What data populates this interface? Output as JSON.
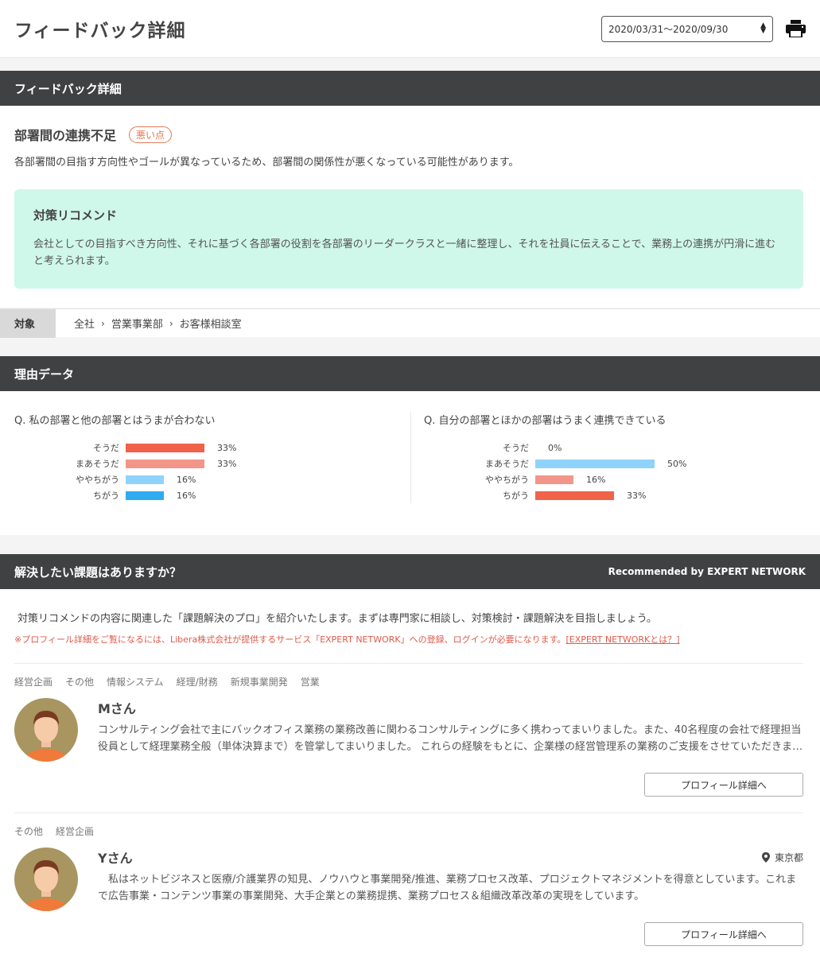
{
  "header": {
    "title": "フィードバック詳細",
    "date_range": "2020/03/31〜2020/09/30",
    "print_icon": "print-icon"
  },
  "feedback": {
    "section_title": "フィードバック詳細",
    "issue_title": "部署間の連携不足",
    "badge": "悪い点",
    "description": "各部署間の目指す方向性やゴールが異なっているため、部署間の関係性が悪くなっている可能性があります。",
    "recommend_title": "対策リコメンド",
    "recommend_body": "会社としての目指すべき方向性、それに基づく各部署の役割を各部署のリーダークラスと一緒に整理し、それを社員に伝えることで、業務上の連携が円滑に進むと考えられます。",
    "target_label": "対象",
    "breadcrumb": [
      "全社",
      "営業事業部",
      "お客様相談室"
    ]
  },
  "reason": {
    "section_title": "理由データ",
    "questions": [
      {
        "title": "Q.  私の部署と他の部署とはうまが合わない",
        "rows": [
          {
            "label": "そうだ",
            "value": 33,
            "display": "33%",
            "color": "#f0624a"
          },
          {
            "label": "まあそうだ",
            "value": 33,
            "display": "33%",
            "color": "#f2968a"
          },
          {
            "label": "ややちがう",
            "value": 16,
            "display": "16%",
            "color": "#8fd3fb"
          },
          {
            "label": "ちがう",
            "value": 16,
            "display": "16%",
            "color": "#2eacef"
          }
        ]
      },
      {
        "title": "Q.  自分の部署とほかの部署はうまく連携できている",
        "rows": [
          {
            "label": "そうだ",
            "value": 0,
            "display": "0%",
            "color": "#f0624a"
          },
          {
            "label": "まあそうだ",
            "value": 50,
            "display": "50%",
            "color": "#8fd3fb"
          },
          {
            "label": "ややちがう",
            "value": 16,
            "display": "16%",
            "color": "#f2968a"
          },
          {
            "label": "ちがう",
            "value": 33,
            "display": "33%",
            "color": "#f0624a"
          }
        ]
      }
    ]
  },
  "experts": {
    "section_title": "解決したい課題はありますか？",
    "recommended_by": "Recommended by EXPERT NETWORK",
    "intro": "対策リコメンドの内容に関連した「課題解決のプロ」を紹介いたします。まずは専門家に相談し、対策検討・課題解決を目指しましょう。",
    "notice": "※プロフィール詳細をご覧になるには、Libera株式会社が提供するサービス「EXPERT NETWORK」への登録、ログインが必要になります。",
    "notice_link": "[EXPERT NETWORKとは？]",
    "list": [
      {
        "tags": [
          "経営企画",
          "その他",
          "情報システム",
          "経理/財務",
          "新規事業開発",
          "営業"
        ],
        "name": "Mさん",
        "location": "",
        "description": "コンサルティング会社で主にバックオフィス業務の業務改善に関わるコンサルティングに多く携わってまいりました。また、40名程度の会社で経理担当役員として経理業務全般（単体決算まで）を管掌してまいりました。 これらの経験をもとに、企業様の経営管理系の業務のご支援をさせていただきます。",
        "button": "プロフィール詳細へ"
      },
      {
        "tags": [
          "その他",
          "経営企画"
        ],
        "name": "Yさん",
        "location": "東京都",
        "description": "　私はネットビジネスと医療/介護業界の知見、ノウハウと事業開発/推進、業務プロセス改革、プロジェクトマネジメントを得意としています。これまで広告事業・コンテンツ事業の事業開発、大手企業との業務提携、業務プロセス＆組織改革改革の実現をしています。",
        "button": "プロフィール詳細へ"
      }
    ]
  }
}
